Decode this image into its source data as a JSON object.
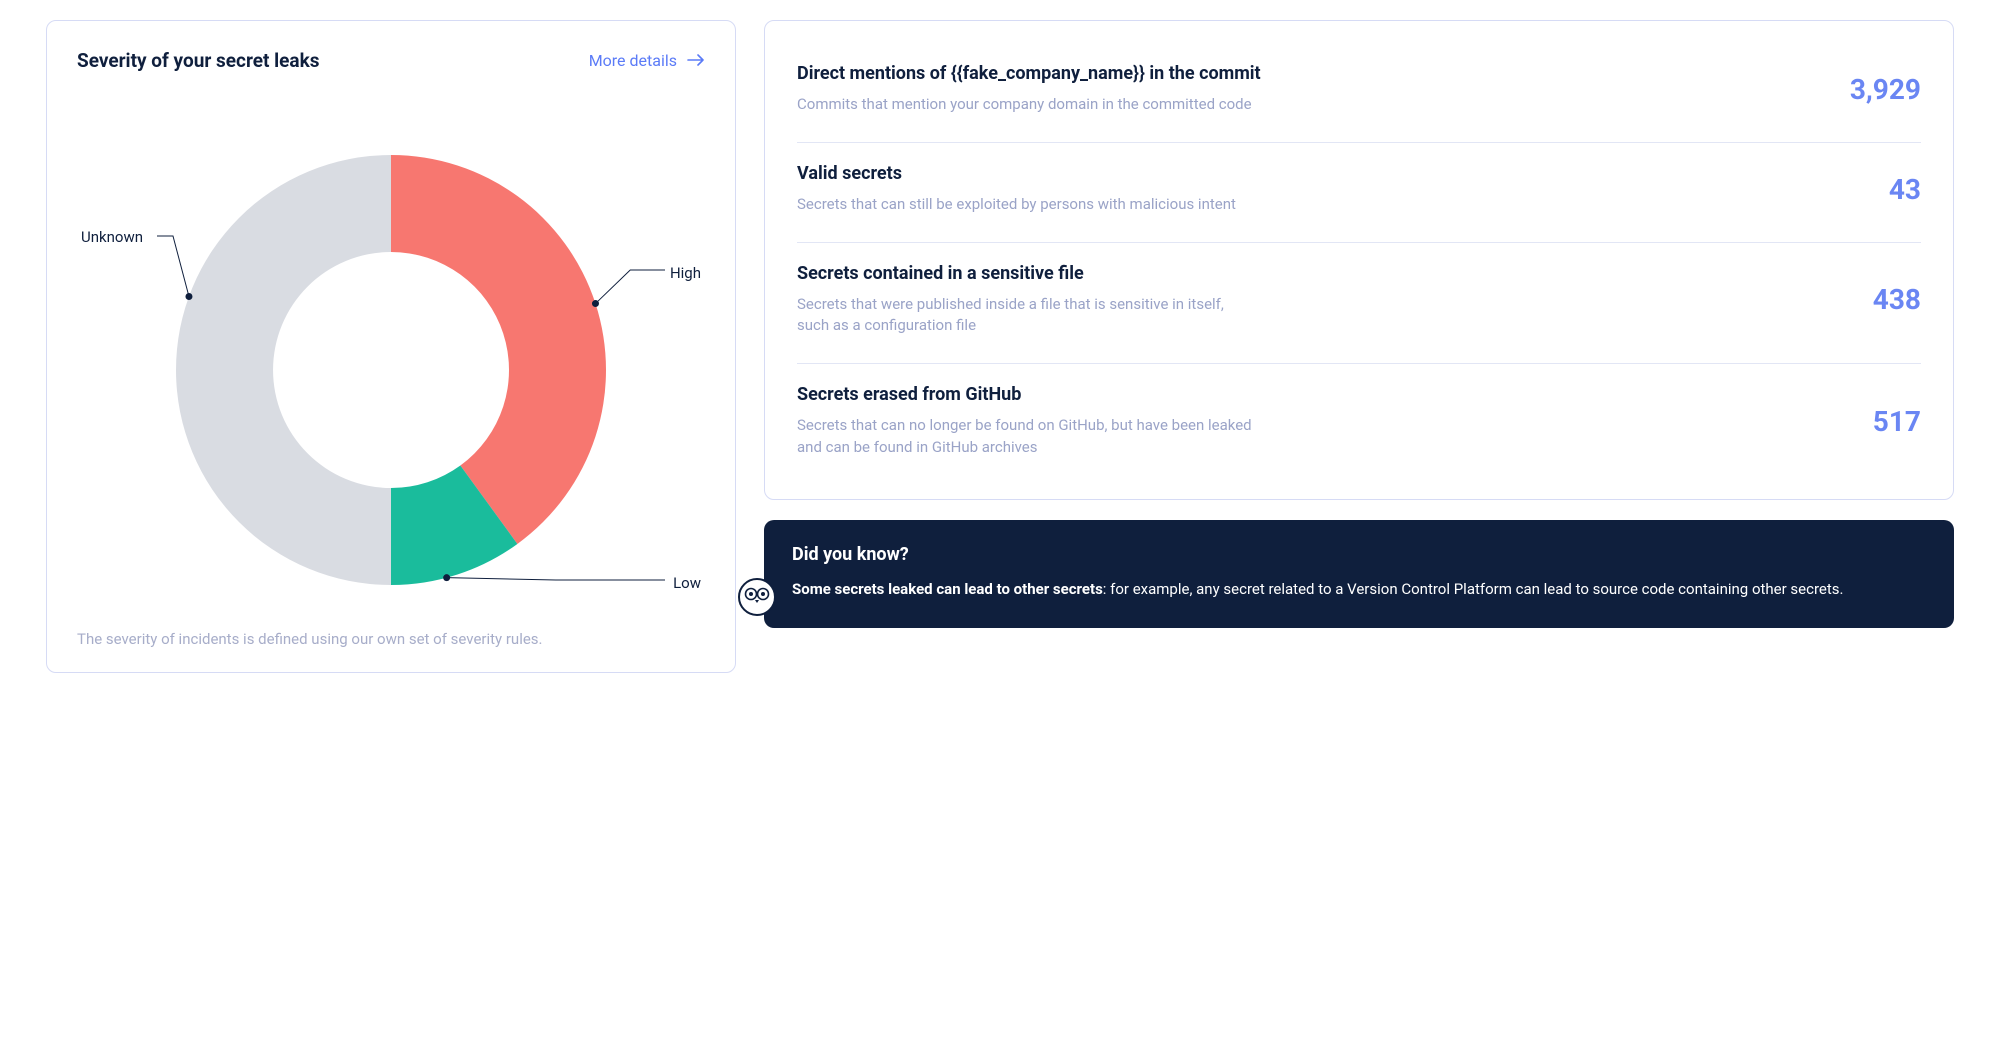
{
  "severity": {
    "title": "Severity of your secret leaks",
    "more_link": "More details",
    "caption": "The severity of incidents is defined using our own set of severity rules.",
    "labels": {
      "unknown": "Unknown",
      "high": "High",
      "low": "Low"
    }
  },
  "chart_data": {
    "type": "pie",
    "title": "Severity of your secret leaks",
    "categories": [
      "High",
      "Low",
      "Unknown"
    ],
    "values": [
      40,
      10,
      50
    ],
    "colors": [
      "#f77770",
      "#1abc9c",
      "#d9dce2"
    ],
    "donut": true
  },
  "stats": [
    {
      "title": "Direct mentions of {{fake_company_name}} in the commit",
      "desc": "Commits that mention your company domain  in the committed code",
      "value": "3,929"
    },
    {
      "title": "Valid secrets",
      "desc": "Secrets that can still be exploited by persons with malicious intent",
      "value": "43"
    },
    {
      "title": "Secrets contained in a sensitive file",
      "desc": "Secrets that were published inside a file that is sensitive in itself, such as a configuration file",
      "value": "438"
    },
    {
      "title": "Secrets erased from GitHub",
      "desc": "Secrets that can no longer be found on GitHub, but have been leaked  and can be found in GitHub archives",
      "value": "517"
    }
  ],
  "info": {
    "title": "Did you know?",
    "body_bold": "Some secrets leaked can lead to other secrets",
    "body_rest": ": for example, any secret related to a Version Control Platform can lead to source code containing other secrets."
  }
}
